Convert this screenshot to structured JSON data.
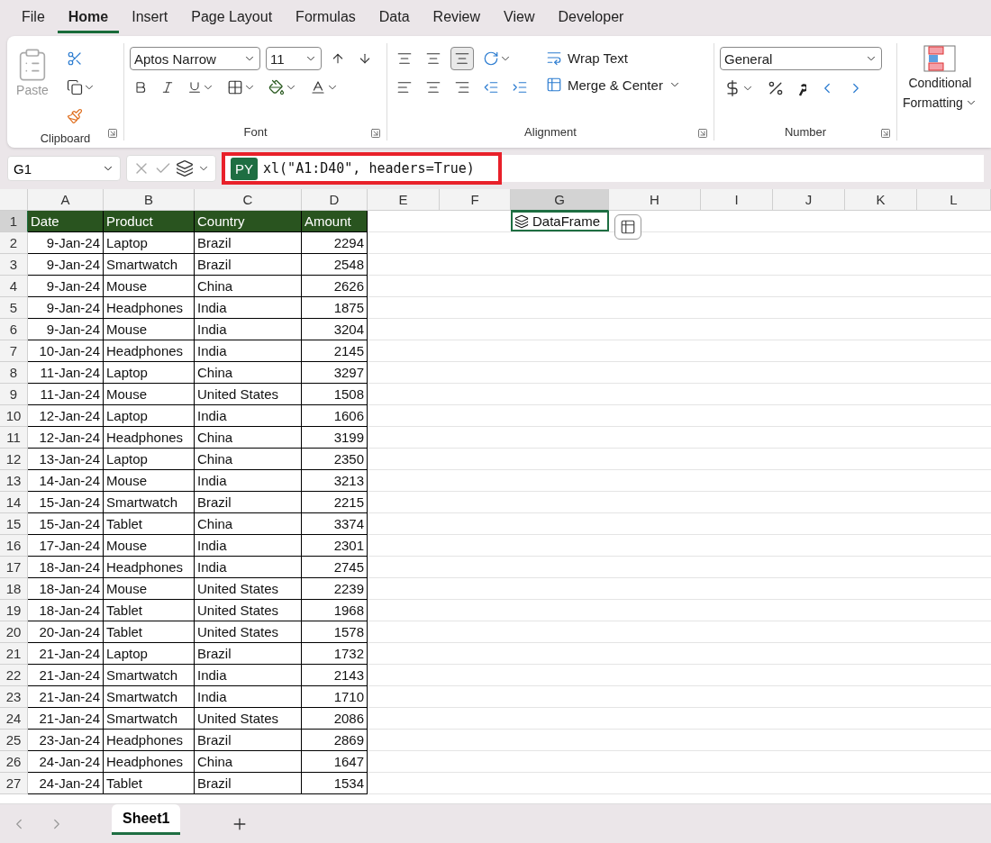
{
  "menu_tabs": [
    {
      "label": "File",
      "selected": false
    },
    {
      "label": "Home",
      "selected": true
    },
    {
      "label": "Insert",
      "selected": false
    },
    {
      "label": "Page Layout",
      "selected": false
    },
    {
      "label": "Formulas",
      "selected": false
    },
    {
      "label": "Data",
      "selected": false
    },
    {
      "label": "Review",
      "selected": false
    },
    {
      "label": "View",
      "selected": false
    },
    {
      "label": "Developer",
      "selected": false
    }
  ],
  "ribbon": {
    "clipboard": {
      "label": "Clipboard",
      "paste": "Paste"
    },
    "font": {
      "label": "Font",
      "font_name": "Aptos Narrow",
      "font_size": "11"
    },
    "alignment": {
      "label": "Alignment",
      "wrap_text": "Wrap Text",
      "merge": "Merge & Center"
    },
    "number": {
      "label": "Number",
      "format": "General"
    },
    "styles": {
      "conditional_line1": "Conditional",
      "conditional_line2": "Formatting"
    }
  },
  "formula_bar": {
    "name_box": "G1",
    "badge": "PY",
    "formula": "xl(\"A1:D40\", headers=True)"
  },
  "sheet": {
    "columns": [
      {
        "label": "A",
        "selected": false
      },
      {
        "label": "B",
        "selected": false
      },
      {
        "label": "C",
        "selected": false
      },
      {
        "label": "D",
        "selected": false
      },
      {
        "label": "E",
        "selected": false
      },
      {
        "label": "F",
        "selected": false
      },
      {
        "label": "G",
        "selected": true
      },
      {
        "label": "H",
        "selected": false
      },
      {
        "label": "I",
        "selected": false
      },
      {
        "label": "J",
        "selected": false
      },
      {
        "label": "K",
        "selected": false
      },
      {
        "label": "L",
        "selected": false
      }
    ],
    "header": [
      "Date",
      "Product",
      "Country",
      "Amount"
    ],
    "rows": [
      [
        "9-Jan-24",
        "Laptop",
        "Brazil",
        "2294"
      ],
      [
        "9-Jan-24",
        "Smartwatch",
        "Brazil",
        "2548"
      ],
      [
        "9-Jan-24",
        "Mouse",
        "China",
        "2626"
      ],
      [
        "9-Jan-24",
        "Headphones",
        "India",
        "1875"
      ],
      [
        "9-Jan-24",
        "Mouse",
        "India",
        "3204"
      ],
      [
        "10-Jan-24",
        "Headphones",
        "India",
        "2145"
      ],
      [
        "11-Jan-24",
        "Laptop",
        "China",
        "3297"
      ],
      [
        "11-Jan-24",
        "Mouse",
        "United States",
        "1508"
      ],
      [
        "12-Jan-24",
        "Laptop",
        "India",
        "1606"
      ],
      [
        "12-Jan-24",
        "Headphones",
        "China",
        "3199"
      ],
      [
        "13-Jan-24",
        "Laptop",
        "China",
        "2350"
      ],
      [
        "14-Jan-24",
        "Mouse",
        "India",
        "3213"
      ],
      [
        "15-Jan-24",
        "Smartwatch",
        "Brazil",
        "2215"
      ],
      [
        "15-Jan-24",
        "Tablet",
        "China",
        "3374"
      ],
      [
        "17-Jan-24",
        "Mouse",
        "India",
        "2301"
      ],
      [
        "18-Jan-24",
        "Headphones",
        "India",
        "2745"
      ],
      [
        "18-Jan-24",
        "Mouse",
        "United States",
        "2239"
      ],
      [
        "18-Jan-24",
        "Tablet",
        "United States",
        "1968"
      ],
      [
        "20-Jan-24",
        "Tablet",
        "United States",
        "1578"
      ],
      [
        "21-Jan-24",
        "Laptop",
        "Brazil",
        "1732"
      ],
      [
        "21-Jan-24",
        "Smartwatch",
        "India",
        "2143"
      ],
      [
        "21-Jan-24",
        "Smartwatch",
        "India",
        "1710"
      ],
      [
        "21-Jan-24",
        "Smartwatch",
        "United States",
        "2086"
      ],
      [
        "23-Jan-24",
        "Headphones",
        "Brazil",
        "2869"
      ],
      [
        "24-Jan-24",
        "Headphones",
        "China",
        "1647"
      ],
      [
        "24-Jan-24",
        "Tablet",
        "Brazil",
        "1534"
      ]
    ],
    "row_numbers": [
      {
        "label": "1",
        "selected": true
      },
      {
        "label": "2",
        "selected": false
      },
      {
        "label": "3",
        "selected": false
      },
      {
        "label": "4",
        "selected": false
      },
      {
        "label": "5",
        "selected": false
      },
      {
        "label": "6",
        "selected": false
      },
      {
        "label": "7",
        "selected": false
      },
      {
        "label": "8",
        "selected": false
      },
      {
        "label": "9",
        "selected": false
      },
      {
        "label": "10",
        "selected": false
      },
      {
        "label": "11",
        "selected": false
      },
      {
        "label": "12",
        "selected": false
      },
      {
        "label": "13",
        "selected": false
      },
      {
        "label": "14",
        "selected": false
      },
      {
        "label": "15",
        "selected": false
      },
      {
        "label": "16",
        "selected": false
      },
      {
        "label": "17",
        "selected": false
      },
      {
        "label": "18",
        "selected": false
      },
      {
        "label": "19",
        "selected": false
      },
      {
        "label": "20",
        "selected": false
      },
      {
        "label": "21",
        "selected": false
      },
      {
        "label": "22",
        "selected": false
      },
      {
        "label": "23",
        "selected": false
      },
      {
        "label": "24",
        "selected": false
      },
      {
        "label": "25",
        "selected": false
      },
      {
        "label": "26",
        "selected": false
      },
      {
        "label": "27",
        "selected": false
      }
    ],
    "result_cell": "DataFrame"
  },
  "sheet_tabs": [
    {
      "label": "Sheet1",
      "selected": true
    }
  ]
}
